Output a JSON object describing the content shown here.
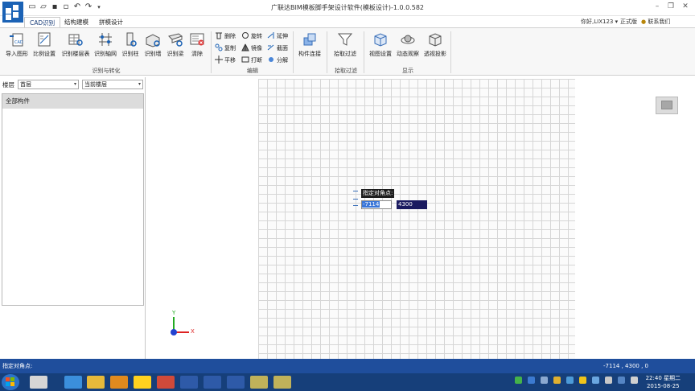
{
  "window": {
    "title": "广联达BIM模板脚手架设计软件(模板设计)-1.0.0.582",
    "controls": [
      "minimize",
      "restore",
      "close"
    ]
  },
  "quick_access": [
    "new-file-icon",
    "open-folder-icon",
    "save-icon",
    "save-as-icon",
    "undo-icon",
    "redo-icon",
    "customize-dropdown-icon"
  ],
  "tabs": [
    {
      "label": "CAD识别",
      "active": true
    },
    {
      "label": "结构建模",
      "active": false
    },
    {
      "label": "拼模设计",
      "active": false
    }
  ],
  "user": {
    "greeting": "你好,LIX123",
    "edition": "正式版",
    "contact": "联系我们"
  },
  "ribbon": {
    "recognize_group": {
      "label": "识别与转化",
      "buttons": [
        {
          "label": "导入图形",
          "icon": "import-cad-icon"
        },
        {
          "label": "比例设置",
          "icon": "scale-settings-icon"
        },
        {
          "label": "识别楼层表",
          "icon": "floor-table-icon"
        },
        {
          "label": "识别轴网",
          "icon": "axis-grid-icon"
        },
        {
          "label": "识别柱",
          "icon": "column-icon"
        },
        {
          "label": "识别墙",
          "icon": "wall-icon"
        },
        {
          "label": "识别梁",
          "icon": "beam-icon"
        },
        {
          "label": "清除",
          "icon": "clear-icon"
        }
      ]
    },
    "edit_group": {
      "label": "编辑",
      "buttons": [
        {
          "label": "删除",
          "icon": "delete-icon"
        },
        {
          "label": "旋转",
          "icon": "rotate-icon"
        },
        {
          "label": "延伸",
          "icon": "extend-icon"
        },
        {
          "label": "复制",
          "icon": "copy-icon"
        },
        {
          "label": "镜像",
          "icon": "mirror-icon"
        },
        {
          "label": "截面",
          "icon": "section-icon"
        },
        {
          "label": "平移",
          "icon": "move-icon"
        },
        {
          "label": "打断",
          "icon": "break-icon"
        },
        {
          "label": "分解",
          "icon": "explode-icon"
        }
      ]
    },
    "connect_group": {
      "label": "",
      "buttons": [
        {
          "label": "构件连接",
          "icon": "component-connect-icon"
        }
      ]
    },
    "filter_group": {
      "label": "拾取过滤",
      "buttons": [
        {
          "label": "拾取过滤",
          "icon": "filter-icon"
        }
      ]
    },
    "display_group": {
      "label": "显示",
      "buttons": [
        {
          "label": "视图设置",
          "icon": "view-settings-icon"
        },
        {
          "label": "动态观察",
          "icon": "orbit-icon"
        },
        {
          "label": "透视投影",
          "icon": "perspective-icon"
        }
      ]
    }
  },
  "floor_bar": {
    "label": "楼层",
    "floor_value": "首层",
    "scope_value": "当前楼层"
  },
  "left_panel": {
    "header": "全部构件"
  },
  "canvas": {
    "prompt": "指定对角点:",
    "x_value": "-7114",
    "y_value": "4300",
    "axis_x_label": "X",
    "axis_y_label": "Y"
  },
  "status": {
    "left_text": "指定对角点:",
    "coords": "-7114 , 4300 , 0"
  },
  "taskbar": {
    "time": "22:40 星期二",
    "date": "2015-08-25"
  },
  "colors": {
    "accent": "#1b62b5",
    "statusbar": "#1f4e9c",
    "taskbar": "#163f7a"
  }
}
